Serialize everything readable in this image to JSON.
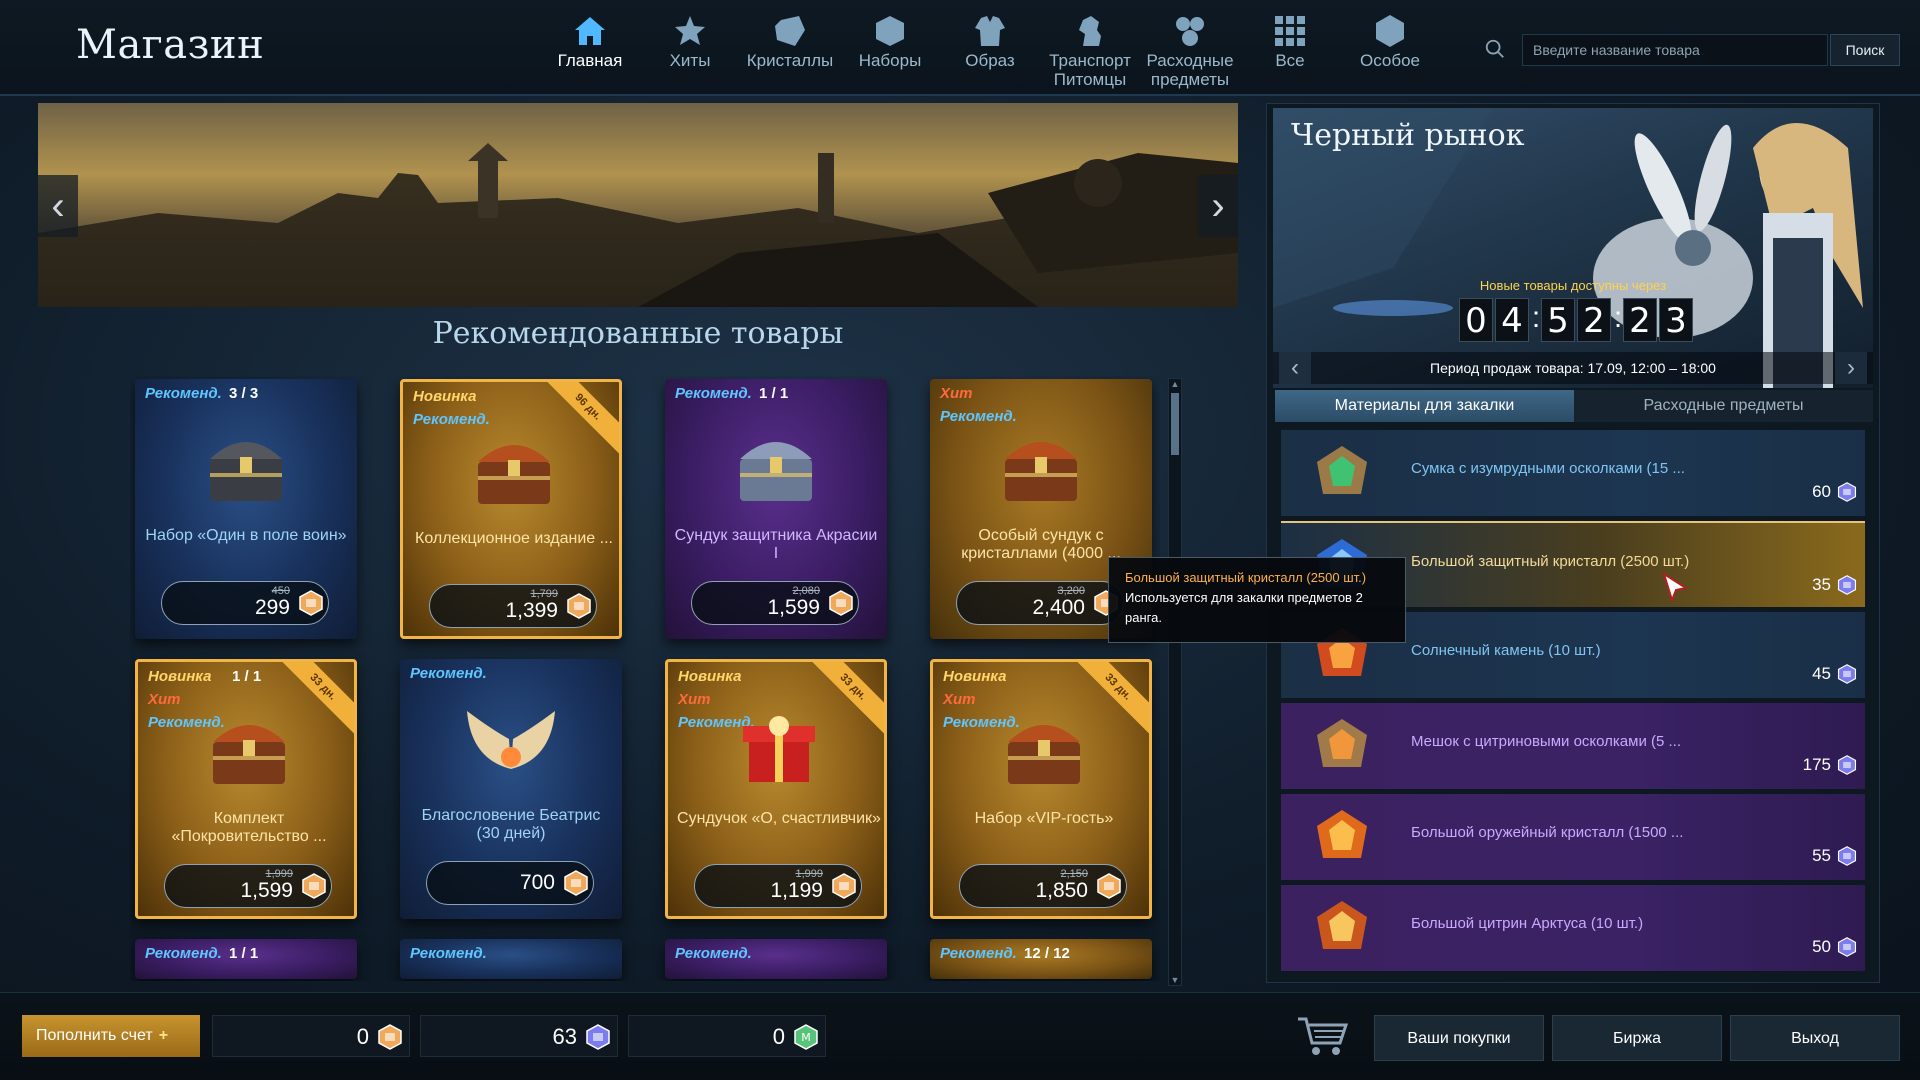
{
  "header": {
    "title": "Магазин",
    "nav": [
      {
        "label": "Главная",
        "icon": "home-icon",
        "active": true
      },
      {
        "label": "Хиты",
        "icon": "star-icon",
        "active": false
      },
      {
        "label": "Кристаллы",
        "icon": "crystal-icon",
        "active": false
      },
      {
        "label": "Наборы",
        "icon": "box-icon",
        "active": false
      },
      {
        "label": "Образ",
        "icon": "outfit-icon",
        "active": false
      },
      {
        "label": "Транспорт Питомцы",
        "icon": "horse-icon",
        "active": false
      },
      {
        "label": "Расходные предметы",
        "icon": "potion-icon",
        "active": false
      },
      {
        "label": "Все",
        "icon": "grid-icon",
        "active": false
      },
      {
        "label": "Особое",
        "icon": "special-icon",
        "active": false
      }
    ],
    "search": {
      "placeholder": "Введите название товара",
      "button": "Поиск"
    }
  },
  "recommended": {
    "title": "Рекомендованные товары",
    "cards": [
      {
        "tags": [
          "Рекоменд."
        ],
        "count": "3 / 3",
        "name": "Набор «Один в поле воин»",
        "old_price": "450",
        "price": "299",
        "style": "blue",
        "ribbon": "",
        "icon": "chest-icon"
      },
      {
        "tags": [
          "Новинка",
          "Рекоменд."
        ],
        "count": "",
        "name": "Коллекционное издание ...",
        "old_price": "1,799",
        "price": "1,399",
        "style": "gold",
        "ribbon": "96 дн.",
        "icon": "chest-icon"
      },
      {
        "tags": [
          "Рекоменд."
        ],
        "count": "1 / 1",
        "name": "Сундук защитника Акрасии I",
        "old_price": "2,080",
        "price": "1,599",
        "style": "purple",
        "ribbon": "",
        "icon": "chest-icon"
      },
      {
        "tags": [
          "Хит",
          "Рекоменд."
        ],
        "count": "",
        "name": "Особый сундук с кристаллами (4000 ...",
        "old_price": "3,200",
        "price": "2,400",
        "style": "gold-plain",
        "ribbon": "",
        "icon": "chest-icon"
      },
      {
        "tags": [
          "Новинка",
          "Хит",
          "Рекоменд."
        ],
        "count": "1 / 1",
        "name": "Комплект «Покровительство ...",
        "old_price": "1,999",
        "price": "1,599",
        "style": "gold",
        "ribbon": "33 дн.",
        "icon": "chest-icon"
      },
      {
        "tags": [
          "Рекоменд."
        ],
        "count": "",
        "name": "Благословение Беатрис (30 дней)",
        "old_price": "",
        "price": "700",
        "style": "blue",
        "ribbon": "",
        "icon": "wings-icon"
      },
      {
        "tags": [
          "Новинка",
          "Хит",
          "Рекоменд."
        ],
        "count": "",
        "name": "Сундучок «О, счастливчик»",
        "old_price": "1,999",
        "price": "1,199",
        "style": "gold",
        "ribbon": "33 дн.",
        "icon": "gift-box-icon"
      },
      {
        "tags": [
          "Новинка",
          "Хит",
          "Рекоменд."
        ],
        "count": "",
        "name": "Набор «VIP-гость»",
        "old_price": "2,150",
        "price": "1,850",
        "style": "gold",
        "ribbon": "33 дн.",
        "icon": "chest-icon"
      },
      {
        "tags": [
          "Рекоменд."
        ],
        "count": "1 / 1",
        "name": "",
        "old_price": "",
        "price": "",
        "style": "purple",
        "ribbon": "",
        "icon": ""
      },
      {
        "tags": [
          "Рекоменд."
        ],
        "count": "",
        "name": "",
        "old_price": "",
        "price": "",
        "style": "blue",
        "ribbon": "",
        "icon": ""
      },
      {
        "tags": [
          "Рекоменд."
        ],
        "count": "",
        "name": "",
        "old_price": "",
        "price": "",
        "style": "purple",
        "ribbon": "",
        "icon": ""
      },
      {
        "tags": [
          "Рекоменд."
        ],
        "count": "12 / 12",
        "name": "",
        "old_price": "",
        "price": "",
        "style": "gold-plain",
        "ribbon": "",
        "icon": ""
      }
    ]
  },
  "tooltip": {
    "title": "Большой защитный кристалл (2500 шт.)",
    "text": "Используется для закалки предметов 2 ранга."
  },
  "black_market": {
    "title": "Черный рынок",
    "note": "Новые товары доступны через",
    "timer_digits": [
      "0",
      "4",
      "5",
      "2",
      "2",
      "3"
    ],
    "period": "Период продаж товара: 17.09, 12:00 – 18:00",
    "tabs": [
      "Материалы для закалки",
      "Расходные предметы"
    ],
    "active_tab": 0,
    "items": [
      {
        "name": "Сумка с изумрудными осколками (15 ...",
        "price": "60",
        "style": "blue",
        "icon": "emerald-bag-icon"
      },
      {
        "name": "Большой защитный кристалл (2500 шт.)",
        "price": "35",
        "style": "selected",
        "icon": "blue-crystal-icon"
      },
      {
        "name": "Солнечный камень (10 шт.)",
        "price": "45",
        "style": "blue",
        "icon": "sunstone-icon"
      },
      {
        "name": "Мешок с цитриновыми осколками (5 ...",
        "price": "175",
        "style": "purple",
        "icon": "citrine-bag-icon"
      },
      {
        "name": "Большой оружейный кристалл (1500 ...",
        "price": "55",
        "style": "purple",
        "icon": "orange-crystal-icon"
      },
      {
        "name": "Большой цитрин Арктуса (10 шт.)",
        "price": "50",
        "style": "purple",
        "icon": "citrine-icon"
      }
    ]
  },
  "footer": {
    "topup": "Пополнить счет",
    "wallets": [
      {
        "value": "0",
        "icon": "coin-icon",
        "color": "#f0a85a"
      },
      {
        "value": "63",
        "icon": "blue-crystal-coin-icon",
        "color": "#7b7cf0"
      },
      {
        "value": "0",
        "icon": "m-coin-icon",
        "color": "#58c47a"
      }
    ],
    "buttons": [
      "Ваши покупки",
      "Биржа",
      "Выход"
    ]
  }
}
